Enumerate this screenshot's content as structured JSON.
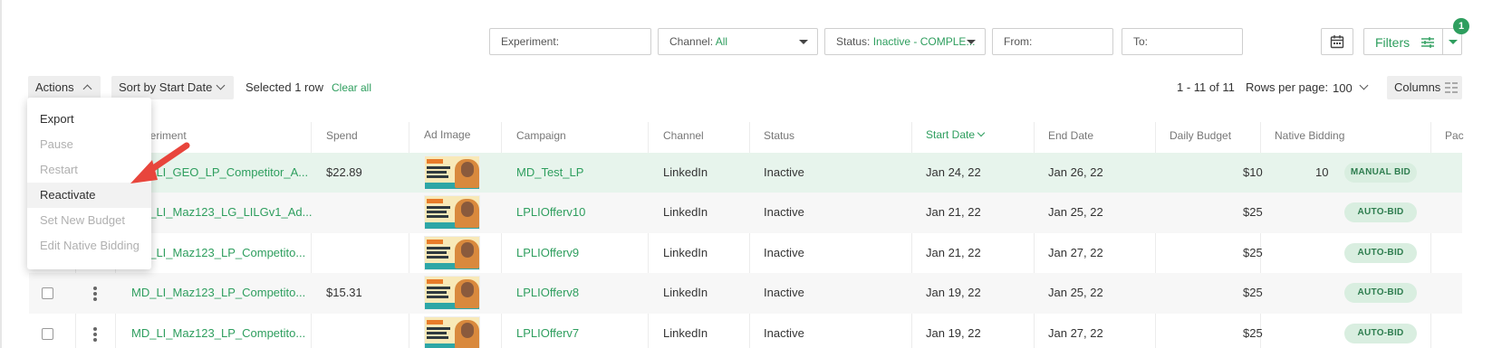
{
  "toolbar": {
    "experiment_label": "Experiment:",
    "channel_label": "Channel:",
    "channel_value": "All",
    "status_label": "Status:",
    "status_value": "Inactive - COMPLE...",
    "from_label": "From:",
    "to_label": "To:",
    "filters_label": "Filters",
    "filters_badge": "1"
  },
  "actionbar": {
    "actions_label": "Actions",
    "sort_label": "Sort by Start Date",
    "selected_text": "Selected 1 row",
    "clear_all": "Clear all",
    "pagination": "1 - 11 of 11",
    "rows_per_page_label": "Rows per page:",
    "rows_per_page_value": "100",
    "columns_label": "Columns"
  },
  "menu": {
    "items": [
      {
        "label": "Export",
        "enabled": true
      },
      {
        "label": "Pause",
        "enabled": false
      },
      {
        "label": "Restart",
        "enabled": false
      },
      {
        "label": "Reactivate",
        "enabled": true
      },
      {
        "label": "Set New Budget",
        "enabled": false
      },
      {
        "label": "Edit Native Bidding",
        "enabled": false
      }
    ]
  },
  "table": {
    "headers": {
      "experiment": "Experiment",
      "spend": "Spend",
      "ad_image": "Ad Image",
      "campaign": "Campaign",
      "channel": "Channel",
      "status": "Status",
      "start_date": "Start Date",
      "end_date": "End Date",
      "daily_budget": "Daily Budget",
      "native_bidding": "Native Bidding",
      "pacing": "Pac"
    },
    "rows": [
      {
        "experiment": "MD_LI_GEO_LP_Competitor_A...",
        "spend": "$22.89",
        "campaign": "MD_Test_LP",
        "channel": "LinkedIn",
        "status": "Inactive",
        "start": "Jan 24, 22",
        "end": "Jan 26, 22",
        "budget": "$10",
        "bid_value": "10",
        "bid_tag": "MANUAL BID"
      },
      {
        "experiment": "MD_LI_Maz123_LG_LILGv1_Ad...",
        "spend": "",
        "campaign": "LPLIOfferv10",
        "channel": "LinkedIn",
        "status": "Inactive",
        "start": "Jan 21, 22",
        "end": "Jan 25, 22",
        "budget": "$25",
        "bid_value": "",
        "bid_tag": "AUTO-BID"
      },
      {
        "experiment": "MD_LI_Maz123_LP_Competito...",
        "spend": "",
        "campaign": "LPLIOfferv9",
        "channel": "LinkedIn",
        "status": "Inactive",
        "start": "Jan 21, 22",
        "end": "Jan 27, 22",
        "budget": "$25",
        "bid_value": "",
        "bid_tag": "AUTO-BID"
      },
      {
        "experiment": "MD_LI_Maz123_LP_Competito...",
        "spend": "$15.31",
        "campaign": "LPLIOfferv8",
        "channel": "LinkedIn",
        "status": "Inactive",
        "start": "Jan 19, 22",
        "end": "Jan 25, 22",
        "budget": "$25",
        "bid_value": "",
        "bid_tag": "AUTO-BID"
      },
      {
        "experiment": "MD_LI_Maz123_LP_Competito...",
        "spend": "",
        "campaign": "LPLIOfferv7",
        "channel": "LinkedIn",
        "status": "Inactive",
        "start": "Jan 19, 22",
        "end": "Jan 27, 22",
        "budget": "$25",
        "bid_value": "",
        "bid_tag": "AUTO-BID"
      }
    ]
  },
  "colors": {
    "accent": "#2e9e5e",
    "selected_row": "#e7f4ec",
    "arrow": "#e8453c"
  }
}
